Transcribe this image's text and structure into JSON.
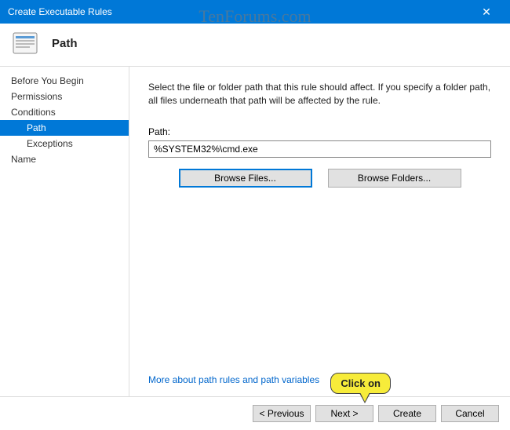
{
  "titlebar": {
    "title": "Create Executable Rules",
    "close": "✕"
  },
  "header": {
    "title": "Path"
  },
  "sidebar": {
    "items": [
      {
        "label": "Before You Begin",
        "indent": false,
        "selected": false
      },
      {
        "label": "Permissions",
        "indent": false,
        "selected": false
      },
      {
        "label": "Conditions",
        "indent": false,
        "selected": false
      },
      {
        "label": "Path",
        "indent": true,
        "selected": true
      },
      {
        "label": "Exceptions",
        "indent": true,
        "selected": false
      },
      {
        "label": "Name",
        "indent": false,
        "selected": false
      }
    ]
  },
  "content": {
    "description": "Select the file or folder path that this rule should affect. If you specify a folder path, all files underneath that path will be affected by the rule.",
    "path_label": "Path:",
    "path_value": "%SYSTEM32%\\cmd.exe",
    "browse_files": "Browse Files...",
    "browse_folders": "Browse Folders...",
    "more_link": "More about path rules and path variables"
  },
  "footer": {
    "previous": "< Previous",
    "next": "Next >",
    "create": "Create",
    "cancel": "Cancel"
  },
  "watermark": "TenForums.com",
  "callout": "Click on"
}
